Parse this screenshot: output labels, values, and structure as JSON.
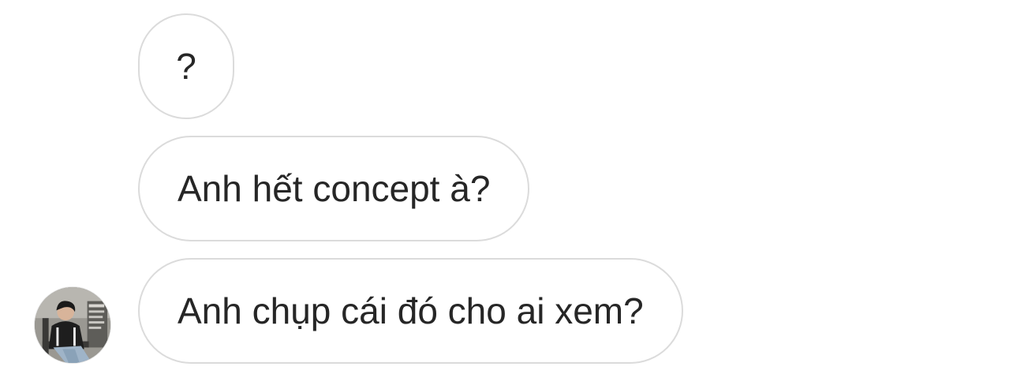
{
  "messages": [
    {
      "text": "?"
    },
    {
      "text": "Anh hết concept à?"
    },
    {
      "text": "Anh chụp cái đó cho ai xem?"
    }
  ],
  "colors": {
    "background": "#ffffff",
    "bubble_border": "#dbdbdb",
    "text": "#262626"
  },
  "avatar": {
    "icon": "profile-photo"
  }
}
